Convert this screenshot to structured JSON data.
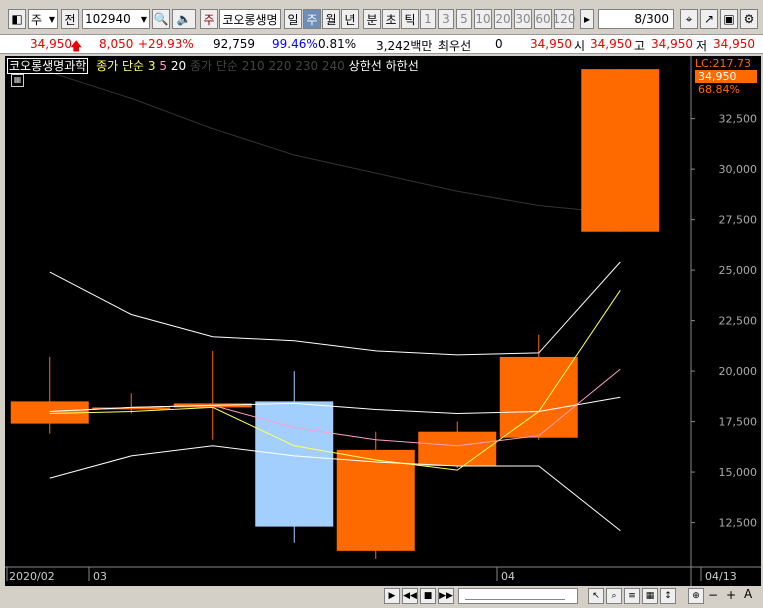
{
  "toolbar": {
    "period_select": "주",
    "prev_label": "전",
    "code": "102940",
    "stock_tag": "주",
    "stock_name": "코오롱생명",
    "period_tabs": [
      "일",
      "주",
      "월",
      "년",
      "분",
      "초",
      "틱"
    ],
    "selected_tab": "주",
    "intervals": [
      "1",
      "3",
      "5",
      "10",
      "20",
      "30",
      "60",
      "120"
    ],
    "count_value": "8",
    "count_total": "/300"
  },
  "quote": {
    "price": "34,950",
    "change": "8,050",
    "change_pct": "+29.93%",
    "volume": "92,759",
    "volume_ratio": "99.46%",
    "turnover": "0.81%",
    "amount": "3,242백만",
    "best_label": "최우선",
    "best_value": "0",
    "current": "34,950",
    "open_label": "시",
    "open": "34,950",
    "high_label": "고",
    "high": "34,950",
    "low_label": "저",
    "low": "34,950"
  },
  "legend": {
    "name": "코오롱생명과학",
    "ma_label": "종가 단순",
    "ma1": "3",
    "ma2": "5",
    "ma3": "20",
    "ma_long": "종가 단순 210 220 230 240",
    "limit_up": "상한선",
    "limit_down": "하한선"
  },
  "price_tag": {
    "lc": "LC:217.73",
    "price": "34,950",
    "pct": "68.84%"
  },
  "colors": {
    "up": "#ff6a00",
    "down": "#a3cfff",
    "ma3": "#ffff60",
    "ma5": "#ff9ec8",
    "ma20": "#ffffff"
  },
  "chart_data": {
    "type": "candlestick",
    "x_labels": [
      "2020/02",
      "03",
      "04",
      "04/13"
    ],
    "y_ticks": [
      12500,
      15000,
      17500,
      20000,
      22500,
      25000,
      27500,
      30000,
      32500
    ],
    "ylim": [
      10300,
      35600
    ],
    "candles": [
      {
        "open": 17400,
        "close": 18500,
        "high": 20700,
        "low": 16900
      },
      {
        "open": 18200,
        "close": 18200,
        "high": 18900,
        "low": 17900
      },
      {
        "open": 18200,
        "close": 18400,
        "high": 21000,
        "low": 16600
      },
      {
        "open": 18500,
        "close": 12300,
        "high": 20000,
        "low": 11500
      },
      {
        "open": 11100,
        "close": 16100,
        "high": 17000,
        "low": 10700
      },
      {
        "open": 15300,
        "close": 17000,
        "high": 17500,
        "low": 15200
      },
      {
        "open": 16700,
        "close": 20700,
        "high": 21800,
        "low": 16600
      },
      {
        "open": 26900,
        "close": 34950,
        "high": 34950,
        "low": 26900
      }
    ],
    "series": [
      {
        "name": "3",
        "values": [
          17900,
          18000,
          18200,
          16300,
          15600,
          15100,
          18000,
          24000
        ]
      },
      {
        "name": "5",
        "values": [
          18000,
          18200,
          18300,
          17200,
          16600,
          16300,
          16800,
          20100
        ]
      },
      {
        "name": "20",
        "values": [
          18000,
          18200,
          18300,
          18400,
          18100,
          17900,
          18000,
          18700
        ]
      },
      {
        "name": "상한선",
        "values": [
          24900,
          22800,
          21700,
          21500,
          21000,
          20800,
          20900,
          25400
        ]
      },
      {
        "name": "하한선",
        "values": [
          14700,
          15800,
          16300,
          15800,
          15500,
          15300,
          15300,
          12100
        ]
      }
    ],
    "long_ma": [
      34800,
      33500,
      32000,
      30700,
      29800,
      28900,
      28200,
      27800
    ]
  }
}
